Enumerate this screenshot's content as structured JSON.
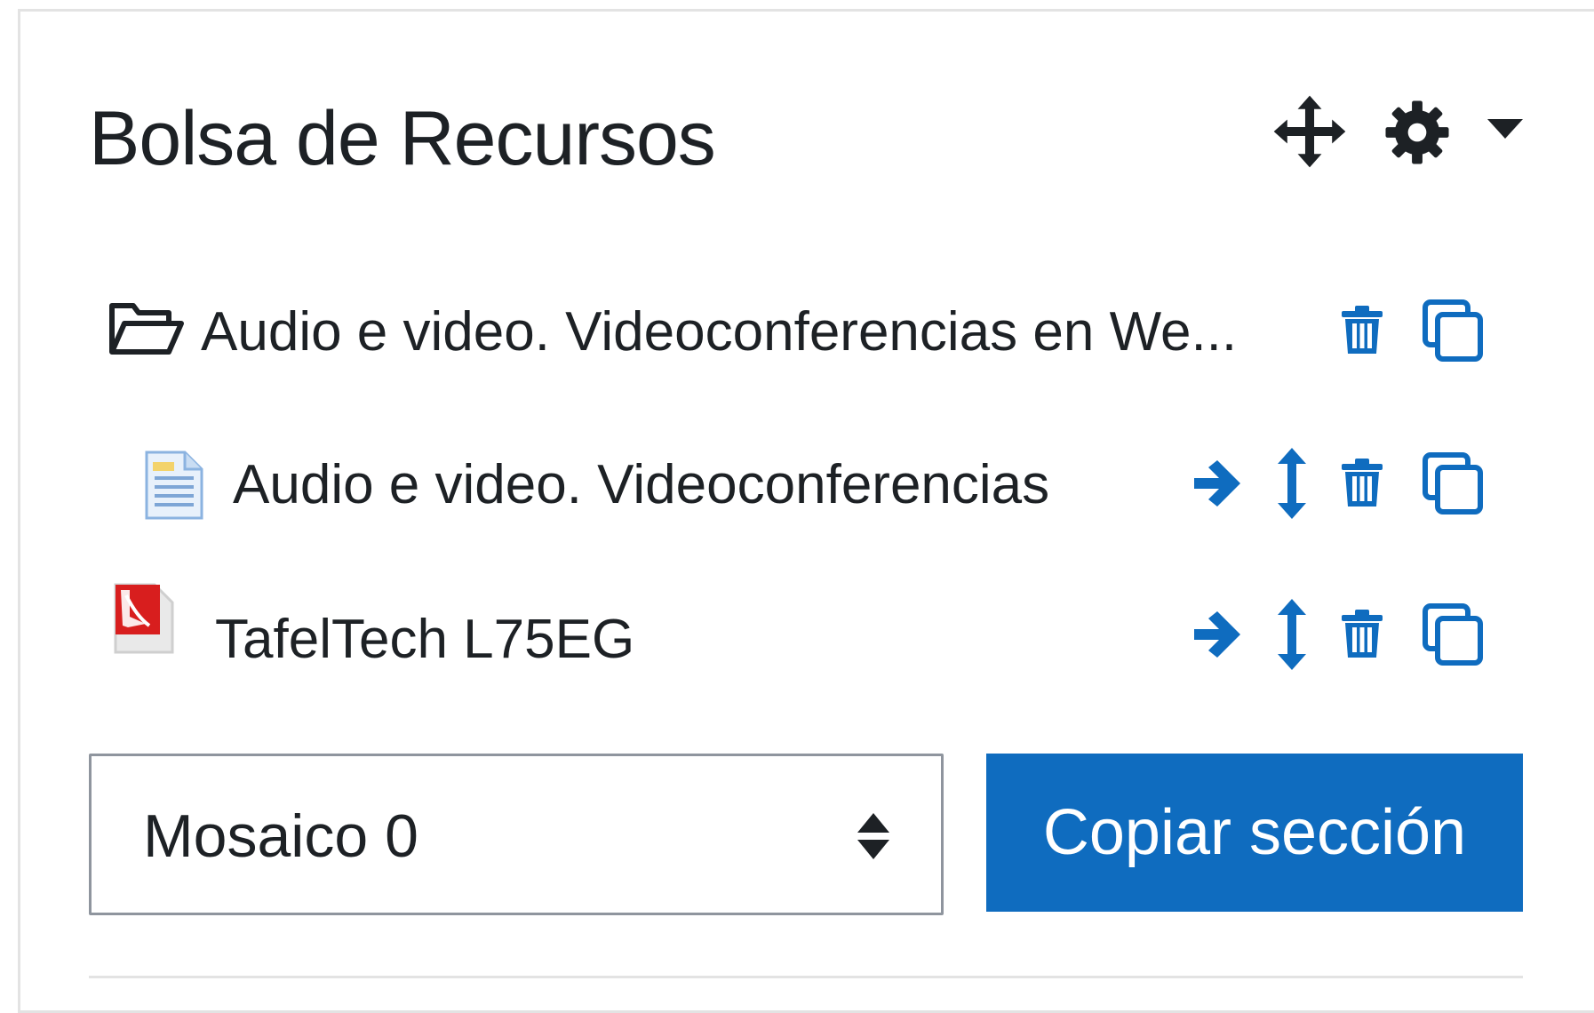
{
  "block": {
    "title": "Bolsa de Recursos",
    "header_icons": [
      "move-icon",
      "gear-icon",
      "caret-down-icon"
    ]
  },
  "resources": [
    {
      "type": "folder",
      "icon": "folder-open-icon",
      "label": "Audio e video. Videoconferencias en We...",
      "actions": [
        "trash-icon",
        "copy-icon"
      ]
    },
    {
      "type": "page",
      "icon": "page-icon",
      "label": "Audio e video. Videoconferencias",
      "actions": [
        "arrow-right-icon",
        "move-vertical-icon",
        "trash-icon",
        "copy-icon"
      ]
    },
    {
      "type": "pdf",
      "icon": "pdf-icon",
      "label": "TafelTech L75EG",
      "actions": [
        "arrow-right-icon",
        "move-vertical-icon",
        "trash-icon",
        "copy-icon"
      ]
    }
  ],
  "section_select": {
    "value": "Mosaico 0"
  },
  "copy_button": {
    "label": "Copiar sección"
  },
  "colors": {
    "action_blue": "#0f6cbf",
    "text": "#1d2125",
    "border": "#8f959e",
    "divider": "#e3e3e3"
  }
}
